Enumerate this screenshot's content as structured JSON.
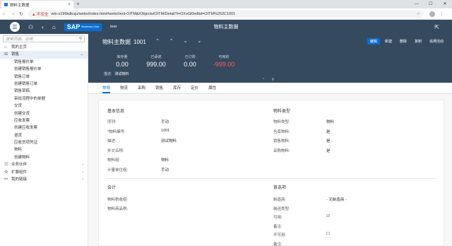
{
  "browser": {
    "tab_title": "物料主数据",
    "close_tab": "×",
    "new_tab": "+",
    "window_controls": [
      "—",
      "☐",
      "✕"
    ],
    "security": "▲ 不安全",
    "url": "win-s199kdkuju/webx/index.html#webclient-OITM&/Objects/OITM/Detail?i=OXvGl0io8id=OITM%252C1001"
  },
  "shell": {
    "logo": "SAP",
    "logo_sub": "Business One",
    "db": "test",
    "title": "物料主数据"
  },
  "sidebar": {
    "search_placeholder": "搜索页面、应用",
    "items": [
      {
        "label": "我的主页",
        "level": "top",
        "icon": "home-icon"
      },
      {
        "label": "销售",
        "level": "top",
        "icon": "sales-icon",
        "expanded": true,
        "selected": true
      },
      {
        "label": "销售报价单",
        "level": "sub"
      },
      {
        "label": "创建销售报价单",
        "level": "sub"
      },
      {
        "label": "销售订单",
        "level": "sub"
      },
      {
        "label": "创建销售订单",
        "level": "sub"
      },
      {
        "label": "销售草稿",
        "level": "sub"
      },
      {
        "label": "审批流程中的单据",
        "level": "sub"
      },
      {
        "label": "交货",
        "level": "sub"
      },
      {
        "label": "创建交货",
        "level": "sub"
      },
      {
        "label": "应收发票",
        "level": "sub"
      },
      {
        "label": "创建应收发票",
        "level": "sub"
      },
      {
        "label": "退货",
        "level": "sub"
      },
      {
        "label": "应收贷项凭证",
        "level": "sub"
      },
      {
        "label": "物料",
        "level": "sub"
      },
      {
        "label": "创建物料",
        "level": "sub"
      },
      {
        "label": "业务伙伴",
        "level": "top",
        "icon": "partner-icon"
      },
      {
        "label": "扩展组件",
        "level": "top",
        "icon": "extension-icon"
      },
      {
        "label": "我的链接",
        "level": "top",
        "icon": "link-icon"
      }
    ]
  },
  "object": {
    "title": "物料主数据",
    "number": "1001",
    "nav_arrows": "⌃ ⌃ ⌄ ⌄",
    "actions": [
      "编辑",
      "新建",
      "删除",
      "复制",
      "追溯活动"
    ],
    "kpis": [
      {
        "label": "库存量",
        "value": "0.00"
      },
      {
        "label": "已承诺",
        "value": "999.00"
      },
      {
        "label": "已订购",
        "value": "0.00"
      },
      {
        "label": "可用的",
        "value": "-999.00",
        "negative": true
      }
    ],
    "desc_label": "描述:",
    "desc_value": "测试物料",
    "collapse": "⌃ ⚲"
  },
  "tabs": [
    "常规",
    "物流",
    "采购",
    "销售",
    "库存",
    "定价",
    "属性"
  ],
  "general": {
    "basic_title": "基本信息",
    "basic_rows": [
      {
        "label": "序列:",
        "value": "手动"
      },
      {
        "label": "*物料编号:",
        "value": "1001"
      },
      {
        "label": "描述:",
        "value": "测试物料"
      },
      {
        "label": "外文名称:",
        "value": ""
      },
      {
        "label": "物料组:",
        "value": "物料"
      },
      {
        "label": "计量单位组:",
        "value": "手动"
      }
    ],
    "type_title": "物料类型",
    "type_rows": [
      {
        "label": "物料类型:",
        "value": "物料"
      },
      {
        "label": "仓库物料:",
        "value": "是"
      },
      {
        "label": "销售物料:",
        "value": "是"
      },
      {
        "label": "采购物料:",
        "value": "是"
      }
    ],
    "accounting_title": "会计",
    "accounting_rows": [
      {
        "label": "物料税收组:",
        "value": ""
      },
      {
        "label": "物料商品税:",
        "value": ""
      }
    ],
    "options_title": "首选项",
    "options_rows": [
      {
        "label": "制造商:",
        "value": "- 无制造商 -"
      },
      {
        "label": "装运类型:",
        "value": ""
      },
      {
        "label": "可用:",
        "value": "☑"
      },
      {
        "label": "备注:",
        "value": ""
      },
      {
        "label": "不可用:",
        "value": "☐"
      },
      {
        "label": "备注:",
        "value": ""
      }
    ]
  }
}
